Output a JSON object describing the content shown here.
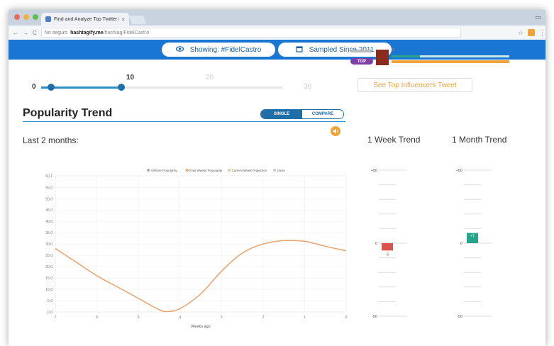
{
  "browser": {
    "tab_title": "Find and Analyze Top Twitter Hashtags",
    "tab_close": "×",
    "nav_back": "←",
    "nav_forward": "→",
    "nav_reload": "C",
    "url_security": "No seguro",
    "url_host": "hashtagify.me",
    "url_path": "/hashtag/FidelCastro",
    "bookmark_icon": "☆",
    "menu_icon": "⋮",
    "window_max": "▭"
  },
  "header": {
    "showing_label": "Showing: #FidelCastro",
    "sampled_label": "Sampled Since 2011",
    "eye_icon": "eye-icon",
    "calendar_icon": "calendar-icon"
  },
  "influencer": {
    "badge": "TOP",
    "zero_label": "0"
  },
  "slider": {
    "min_label": "0",
    "value_label": "10",
    "faint_mid": "20",
    "faint_max": "30",
    "value": 10,
    "max": 30
  },
  "see_top_button": "See Top Influencers Tweet",
  "trend": {
    "title": "Popularity Trend",
    "toggle_single": "SINGLE",
    "toggle_compare": "COMPARE",
    "period_label": "Last 2 months:",
    "week_title": "1 Week Trend",
    "month_title": "1 Month Trend",
    "speaker_icon": "speaker-icon"
  },
  "colors": {
    "brand_blue": "#1976d2",
    "accent_orange": "#f2a23a",
    "line_orange": "#e8a672",
    "week_red": "#d9534f",
    "month_green": "#27a58a"
  },
  "chart_data": {
    "type": "line",
    "legend": [
      "All-time Popularity",
      "Past Weeks Popularity",
      "Current Week Projection",
      "zoom"
    ],
    "legend_position": "top-right",
    "xlabel": "Weeks ago",
    "x_ticks": [
      "7",
      "6",
      "5",
      "4",
      "3",
      "2",
      "1",
      "0"
    ],
    "y_ticks": [
      "0.0",
      "5.0",
      "10.0",
      "15.0",
      "20.0",
      "25.0",
      "30.0",
      "35.0",
      "40.0",
      "45.0",
      "50.0",
      "55.0",
      "60.1"
    ],
    "ylim": [
      0,
      60.1
    ],
    "xlim": [
      7,
      0
    ],
    "grid": true,
    "series": [
      {
        "name": "Past Weeks Popularity",
        "x": [
          7,
          6.5,
          6,
          5.5,
          5,
          4.5,
          4.3,
          4,
          3.5,
          3,
          2.5,
          2,
          1.5,
          1,
          0.5,
          0
        ],
        "y": [
          28,
          22,
          16,
          11,
          6,
          1,
          0.2,
          1.5,
          8,
          18,
          26,
          30,
          31.5,
          31.2,
          29,
          27
        ]
      }
    ]
  },
  "week_trend": {
    "top_label": "+50",
    "mid_label": "0",
    "bottom_label": "-50",
    "value": -5,
    "bar_label": "-5"
  },
  "month_trend": {
    "top_label": "+50",
    "mid_label": "0",
    "bottom_label": "-50",
    "value": 7,
    "bar_label": "+7"
  }
}
